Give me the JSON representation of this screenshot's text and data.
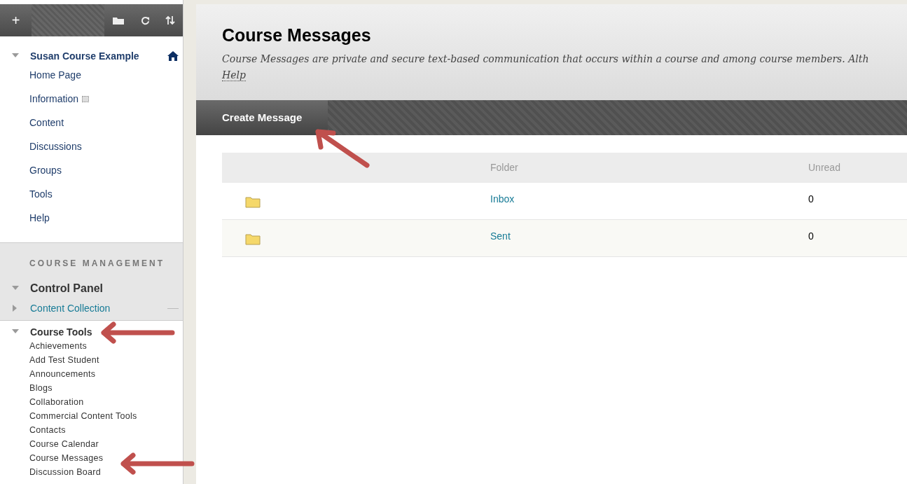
{
  "toolbar": {
    "add_label": "+"
  },
  "course": {
    "title": "Course Example",
    "owner": "Susan",
    "expanded": true,
    "items": [
      {
        "label": "Home Page",
        "kind": "link"
      },
      {
        "label": "Information",
        "kind": "hidden"
      },
      {
        "label": "Content",
        "kind": "link"
      },
      {
        "label": "Discussions",
        "kind": "link"
      },
      {
        "label": "Groups",
        "kind": "link"
      },
      {
        "label": "Tools",
        "kind": "link"
      },
      {
        "label": "Help",
        "kind": "link"
      }
    ]
  },
  "management": {
    "heading": "COURSE MANAGEMENT",
    "panel": {
      "label": "Control Panel",
      "expanded": true
    },
    "collection": {
      "label": "Content Collection",
      "expanded": false
    },
    "tools": {
      "label": "Course Tools",
      "expanded": true,
      "items": [
        "Achievements",
        "Add Test Student",
        "Announcements",
        "Blogs",
        "Collaboration",
        "Commercial Content Tools",
        "Contacts",
        "Course Calendar",
        "Course Messages",
        "Discussion Board"
      ]
    }
  },
  "page": {
    "title": "Course Messages",
    "description": "Course Messages are private and secure text-based communication that occurs within a course and among course members. Alth",
    "help": "Help"
  },
  "action_bar": {
    "buttons": [
      "Create Message"
    ]
  },
  "table": {
    "columns": [
      "Folder",
      "Unread"
    ],
    "rows": [
      {
        "folder": "Inbox",
        "unread": "0"
      },
      {
        "folder": "Sent",
        "unread": "0"
      }
    ]
  }
}
